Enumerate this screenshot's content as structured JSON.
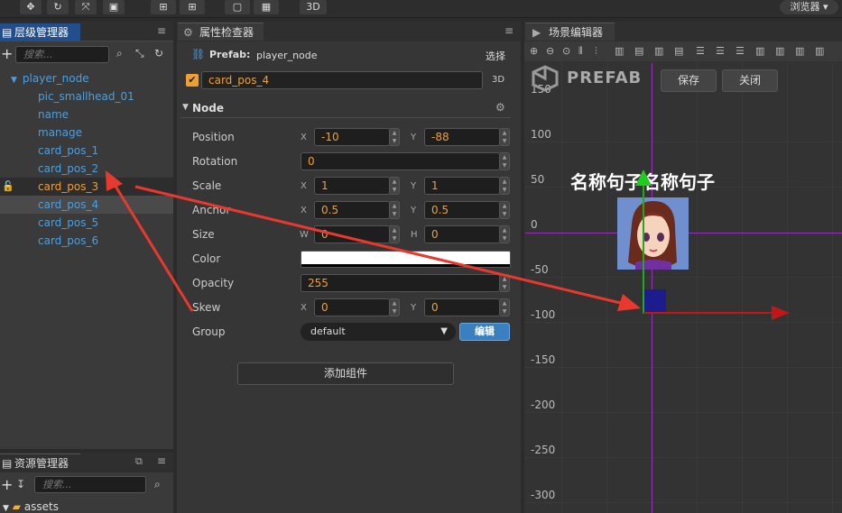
{
  "top_toolbar": {
    "mode_3d": "3D",
    "browse_menu": "浏览器"
  },
  "hierarchy": {
    "title": "层级管理器",
    "search_placeholder": "搜索...",
    "root": "player_node",
    "children": [
      "pic_smallhead_01",
      "name",
      "manage",
      "card_pos_1",
      "card_pos_2",
      "card_pos_3",
      "card_pos_4",
      "card_pos_5",
      "card_pos_6"
    ],
    "highlighted_index": 5,
    "selected_index": 6
  },
  "assets": {
    "title": "资源管理器",
    "search_placeholder": "搜索...",
    "root": "assets"
  },
  "inspector": {
    "title": "属性检查器",
    "prefab_label": "Prefab:",
    "prefab_name": "player_node",
    "select_label": "选择",
    "node_name": "card_pos_4",
    "mode_3d": "3D",
    "section": "Node",
    "props": {
      "position": {
        "label": "Position",
        "x_axis": "X",
        "x": "-10",
        "y_axis": "Y",
        "y": "-88"
      },
      "rotation": {
        "label": "Rotation",
        "value": "0"
      },
      "scale": {
        "label": "Scale",
        "x_axis": "X",
        "x": "1",
        "y_axis": "Y",
        "y": "1"
      },
      "anchor": {
        "label": "Anchor",
        "x_axis": "X",
        "x": "0.5",
        "y_axis": "Y",
        "y": "0.5"
      },
      "size": {
        "label": "Size",
        "w_axis": "W",
        "w": "0",
        "h_axis": "H",
        "h": "0"
      },
      "color": {
        "label": "Color",
        "value": "#ffffff"
      },
      "opacity": {
        "label": "Opacity",
        "value": "255"
      },
      "skew": {
        "label": "Skew",
        "x_axis": "X",
        "x": "0",
        "y_axis": "Y",
        "y": "0"
      },
      "group": {
        "label": "Group",
        "value": "default",
        "edit": "编辑"
      }
    },
    "add_component": "添加组件"
  },
  "scene": {
    "title": "场景编辑器",
    "prefab_text": "PREFAB",
    "save_button": "保存",
    "close_button": "关闭",
    "canvas_text": "名称句子名称句子",
    "rulers": [
      "150",
      "100",
      "50",
      "0",
      "-50",
      "-100",
      "-150",
      "-200",
      "-250",
      "-300"
    ]
  },
  "colors": {
    "accent": "#234e8c",
    "tree_text": "#4b9fe0",
    "highlight": "#f0a030",
    "annotation": "#e8392f"
  }
}
